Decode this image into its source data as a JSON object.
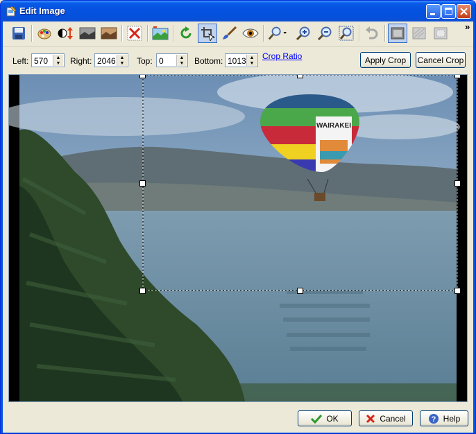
{
  "window": {
    "title": "Edit Image"
  },
  "toolbar": {
    "tools": [
      {
        "name": "save-icon"
      },
      {
        "name": "palette-icon"
      },
      {
        "name": "contrast-icon"
      },
      {
        "name": "grayscale-photo-icon"
      },
      {
        "name": "sepia-photo-icon"
      },
      {
        "name": "delete-icon"
      },
      {
        "name": "landscape-icon"
      },
      {
        "name": "rotate-icon"
      },
      {
        "name": "crop-icon"
      },
      {
        "name": "brush-icon"
      },
      {
        "name": "red-eye-icon"
      },
      {
        "name": "zoom-icon"
      },
      {
        "name": "zoom-in-icon"
      },
      {
        "name": "zoom-out-icon"
      },
      {
        "name": "zoom-fit-icon"
      },
      {
        "name": "undo-icon"
      },
      {
        "name": "frame-icon"
      },
      {
        "name": "texture-icon"
      },
      {
        "name": "vignette-icon"
      }
    ],
    "overflow": "»"
  },
  "crop": {
    "left_label": "Left:",
    "left_value": "570",
    "right_label": "Right:",
    "right_value": "2046",
    "top_label": "Top:",
    "top_value": "0",
    "bottom_label": "Bottom:",
    "bottom_value": "1013",
    "ratio_link": "Crop Ratio",
    "apply_label": "Apply Crop",
    "cancel_label": "Cancel Crop"
  },
  "balloon_text": "WAIRAKEI",
  "footer": {
    "ok_label": "OK",
    "cancel_label": "Cancel",
    "help_label": "Help"
  },
  "colors": {
    "title_blue": "#0054e3",
    "dialog_bg": "#ece9d8",
    "link": "#0000ff"
  }
}
